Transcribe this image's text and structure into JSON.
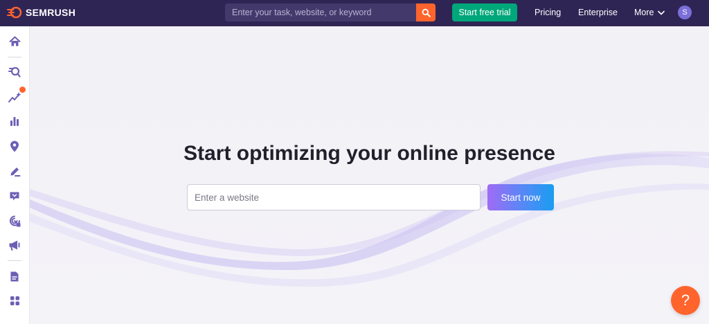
{
  "header": {
    "brand": "SEMRUSH",
    "search": {
      "placeholder": "Enter your task, website, or keyword",
      "icon": "search-icon"
    },
    "trial_label": "Start free trial",
    "nav": {
      "pricing": "Pricing",
      "enterprise": "Enterprise",
      "more": "More"
    },
    "avatar_initial": "S"
  },
  "sidebar": {
    "items": [
      {
        "icon": "home-icon"
      },
      {
        "icon": "seo-icon"
      },
      {
        "icon": "ai-trends-icon",
        "badge": true
      },
      {
        "icon": "bar-chart-icon"
      },
      {
        "icon": "location-pin-icon"
      },
      {
        "icon": "content-edit-icon"
      },
      {
        "icon": "social-chat-icon"
      },
      {
        "icon": "target-icon"
      },
      {
        "icon": "megaphone-icon"
      },
      {
        "icon": "document-icon"
      },
      {
        "icon": "apps-grid-icon"
      }
    ]
  },
  "main": {
    "headline": "Start optimizing your online presence",
    "website_input": {
      "placeholder": "Enter a website",
      "value": ""
    },
    "start_label": "Start now"
  },
  "help": {
    "label": "?"
  },
  "colors": {
    "topbar": "#2f2555",
    "accent_orange": "#ff642d",
    "trial_green": "#00a77a",
    "icon_purple": "#6b5fb5"
  }
}
